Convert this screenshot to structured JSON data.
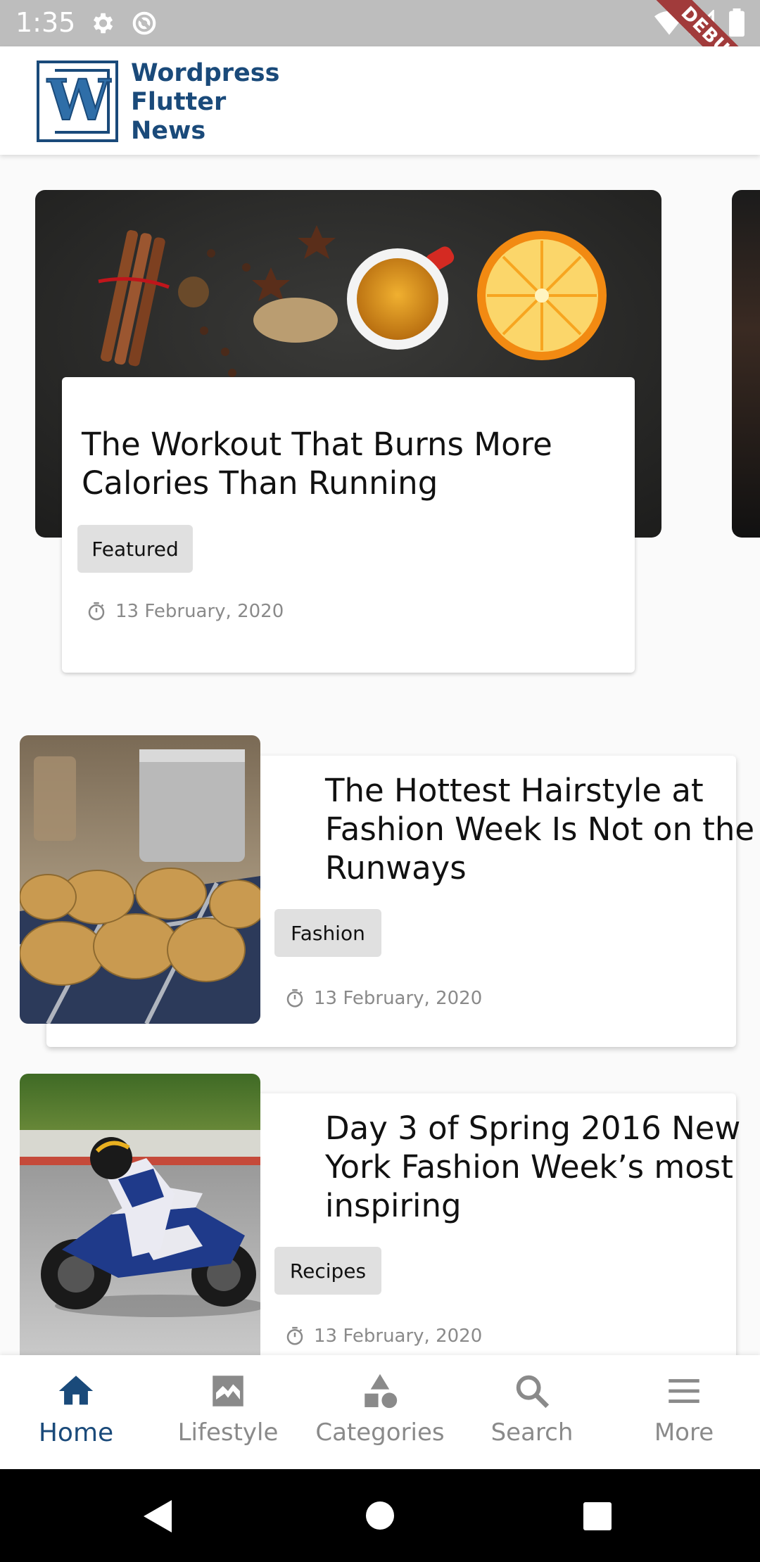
{
  "status_bar": {
    "time": "1:35",
    "debug_label": "DEBUG"
  },
  "app_bar": {
    "logo_letter": "W",
    "logo_text": [
      "Wordpress",
      "Flutter",
      "News"
    ],
    "brand_color": "#1a4a7a"
  },
  "featured": {
    "title": "The Workout That Burns More Calories Than Running",
    "category": "Featured",
    "date": "13 February, 2020"
  },
  "articles": [
    {
      "title": "The Hottest Hairstyle at Fashion Week Is Not on the Runways",
      "category": "Fashion",
      "date": "13 February, 2020",
      "image": "potatoes"
    },
    {
      "title": "Day 3 of Spring 2016 New York Fashion Week’s most inspiring",
      "category": "Recipes",
      "date": "13 February, 2020",
      "image": "motorcycle"
    }
  ],
  "bottom_nav": {
    "items": [
      {
        "label": "Home",
        "icon": "home-icon",
        "active": true
      },
      {
        "label": "Lifestyle",
        "icon": "image-icon",
        "active": false
      },
      {
        "label": "Categories",
        "icon": "category-icon",
        "active": false
      },
      {
        "label": "Search",
        "icon": "search-icon",
        "active": false
      },
      {
        "label": "More",
        "icon": "menu-icon",
        "active": false
      }
    ],
    "active_color": "#1a4a7a",
    "inactive_color": "#8a8a8a"
  }
}
